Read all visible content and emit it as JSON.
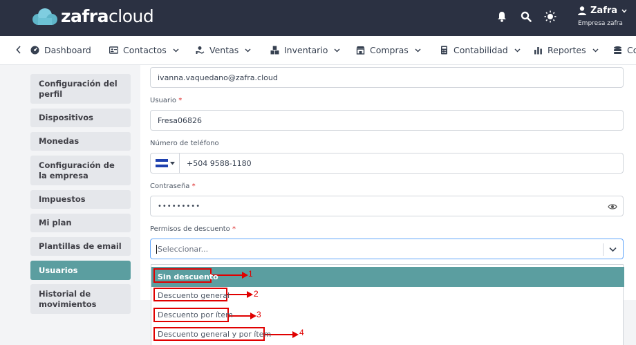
{
  "brand": {
    "logo_bold": "zafra",
    "logo_light": "cloud"
  },
  "user": {
    "name": "Zafra",
    "company": "Empresa zafra"
  },
  "nav": {
    "items": [
      {
        "label": "Dashboard",
        "icon": "dashboard-icon"
      },
      {
        "label": "Contactos",
        "icon": "contacts-icon"
      },
      {
        "label": "Ventas",
        "icon": "sales-icon"
      },
      {
        "label": "Inventario",
        "icon": "inventory-icon"
      },
      {
        "label": "Compras",
        "icon": "store-icon"
      },
      {
        "label": "Contabilidad",
        "icon": "calculator-icon"
      },
      {
        "label": "Reportes",
        "icon": "bar-chart-icon"
      },
      {
        "label": "Co",
        "icon": "stack-icon"
      }
    ]
  },
  "sidebar": {
    "items": [
      {
        "label": "Configuración del perfil"
      },
      {
        "label": "Dispositivos"
      },
      {
        "label": "Monedas"
      },
      {
        "label": "Configuración de la empresa"
      },
      {
        "label": "Impuestos"
      },
      {
        "label": "Mi plan"
      },
      {
        "label": "Plantillas de email"
      },
      {
        "label": "Usuarios",
        "active": true
      },
      {
        "label": "Historial de movimientos"
      }
    ]
  },
  "form": {
    "email_value": "ivanna.vaquedano@zafra.cloud",
    "username_label": "Usuario",
    "username_value": "Fresa06826",
    "phone_label": "Número de teléfono",
    "phone_value": "+504 9588-1180",
    "password_label": "Contraseña",
    "password_value": "•••••••••",
    "discount_label": "Permisos de descuento",
    "discount_placeholder": "Seleccionar...",
    "required_mark": "*"
  },
  "dropdown": {
    "options": [
      {
        "label": "Sin descuento",
        "selected": true
      },
      {
        "label": "Descuento general"
      },
      {
        "label": "Descuento por ítem"
      },
      {
        "label": "Descuento general y por ítem"
      }
    ]
  },
  "annotations": [
    "1",
    "2",
    "3",
    "4"
  ],
  "colors": {
    "topbar": "#2b3142",
    "accent": "#5b9ea0",
    "annotation": "#e00000"
  }
}
